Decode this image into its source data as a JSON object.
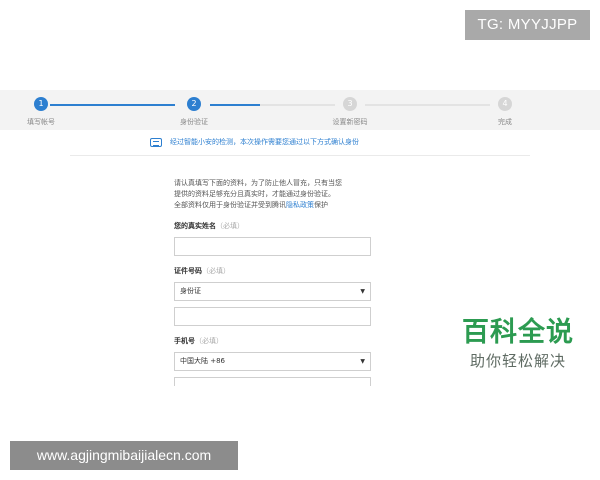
{
  "watermark": {
    "tg": "TG: MYYJJPP",
    "url": "www.agjingmibaijialecn.com"
  },
  "brand": {
    "name": "百科全说",
    "slogan": "助你轻松解决",
    "color": "#2c9b51"
  },
  "steps": [
    {
      "number": "1",
      "label": "填写帐号",
      "state": "done"
    },
    {
      "number": "2",
      "label": "身份验证",
      "state": "current"
    },
    {
      "number": "3",
      "label": "设置新密码",
      "state": "todo"
    },
    {
      "number": "4",
      "label": "完成",
      "state": "todo"
    }
  ],
  "notice": {
    "text": "经过智能小安的检测，本次操作需要您通过以下方式确认身份"
  },
  "form": {
    "intro_line1": "请认真填写下面的资料，为了防止他人冒充，只有当您",
    "intro_line2": "提供的资料足够充分且真实时，才能通过身份验证。",
    "intro_line3": "全部资料仅用于身份验证并受到腾讯",
    "privacy_link": "隐私政策",
    "intro_line3_end": "保护",
    "name_label": "您的真实姓名",
    "required": "（必填）",
    "id_label": "证件号码",
    "id_type_value": "身份证",
    "phone_label": "手机号",
    "phone_region_value": "中国大陆 +86"
  },
  "colors": {
    "accent": "#2d7fd0"
  }
}
